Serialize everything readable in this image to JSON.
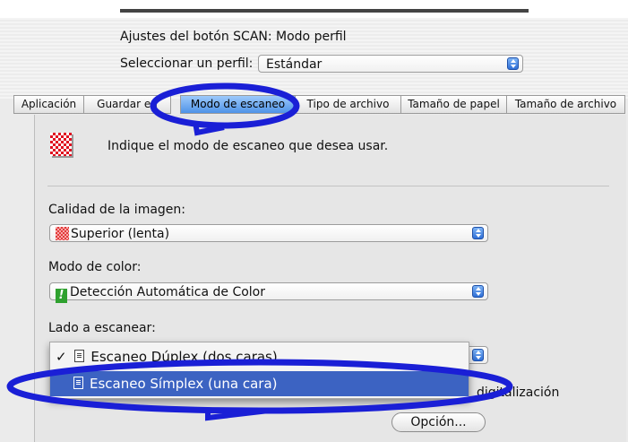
{
  "header": {
    "title": "Ajustes del botón SCAN: Modo perfil",
    "profile_label": "Seleccionar un perfil:",
    "profile_value": "Estándar"
  },
  "tabs": [
    {
      "label": "Aplicación"
    },
    {
      "label": "Guardar en"
    },
    {
      "label": "Modo de escaneo"
    },
    {
      "label": "Tipo de archivo"
    },
    {
      "label": "Tamaño de papel"
    },
    {
      "label": "Tamaño de archivo"
    }
  ],
  "active_tab": "Modo de escaneo",
  "panel": {
    "instruction": "Indique el modo de escaneo que desea usar.",
    "quality_label": "Calidad de la imagen:",
    "quality_value": "Superior (lenta)",
    "color_label": "Modo de color:",
    "color_value": "Detección Automática de Color",
    "side_label": "Lado a escanear:",
    "partial_text": "digitalización",
    "option_button": "Opción..."
  },
  "side_menu": {
    "items": [
      {
        "label": "Escaneo Dúplex (dos caras)",
        "checked": true
      },
      {
        "label": "Escaneo Símplex (una cara)",
        "highlighted": true
      }
    ],
    "check_mark": "✓"
  },
  "colors": {
    "annotation": "#1a1fd6",
    "highlight": "#3c63c2",
    "active_tab": "#4f93e8"
  }
}
